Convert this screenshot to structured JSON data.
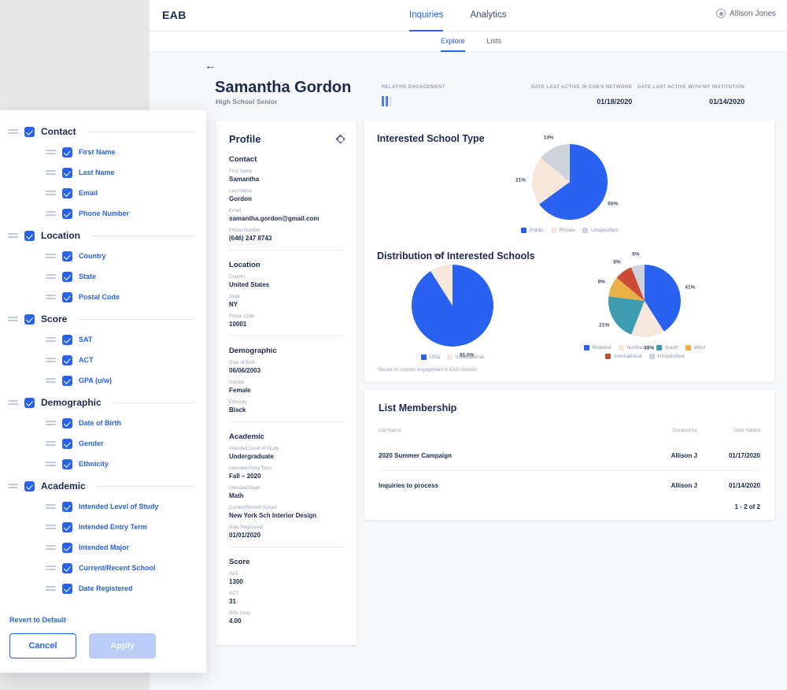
{
  "topbar": {
    "brand": "EAB",
    "nav": [
      {
        "label": "Inquiries",
        "active": true
      },
      {
        "label": "Analytics",
        "active": false
      }
    ],
    "user": "Allison Jones",
    "user_icon": "avatar-icon"
  },
  "subnav": [
    {
      "label": "Explore",
      "active": true
    },
    {
      "label": "Lists",
      "active": false
    }
  ],
  "person": {
    "back_icon": "back-arrow-icon",
    "name": "Samantha Gordon",
    "subtitle": "High School Senior",
    "metrics": [
      {
        "label": "RELATIVE ENGAGEMENT",
        "value": "",
        "bars_on": 2,
        "bars_total": 3
      },
      {
        "label": "DATE LAST ACTIVE IN EAB'S NETWORK",
        "value": "01/18/2020"
      },
      {
        "label": "DATE LAST ACTIVE WITH MY INSTITUTION",
        "value": "01/14/2020"
      }
    ]
  },
  "profile": {
    "title": "Profile",
    "settings_icon": "gear-icon",
    "sections": [
      {
        "title": "Contact",
        "fields": [
          {
            "label": "First Name",
            "value": "Samantha"
          },
          {
            "label": "Last Name",
            "value": "Gordon"
          },
          {
            "label": "Email",
            "value": "samantha.gordon@gmail.com"
          },
          {
            "label": "Phone Number",
            "value": "(646) 247 8743"
          }
        ]
      },
      {
        "title": "Location",
        "fields": [
          {
            "label": "Country",
            "value": "United States"
          },
          {
            "label": "State",
            "value": "NY"
          },
          {
            "label": "Postal Code",
            "value": "10001"
          }
        ]
      },
      {
        "title": "Demographic",
        "fields": [
          {
            "label": "Date of Birth",
            "value": "06/06/2003"
          },
          {
            "label": "Gender",
            "value": "Female"
          },
          {
            "label": "Ethnicity",
            "value": "Black"
          }
        ]
      },
      {
        "title": "Academic",
        "fields": [
          {
            "label": "Intended Level of Study",
            "value": "Undergraduate"
          },
          {
            "label": "Intended Entry Term",
            "value": "Fall – 2020"
          },
          {
            "label": "Intended Major",
            "value": "Math"
          },
          {
            "label": "Current/Recent School",
            "value": "New York Sch Interior Design"
          },
          {
            "label": "Date Registered",
            "value": "01/01/2020"
          }
        ]
      },
      {
        "title": "Score",
        "fields": [
          {
            "label": "SAT",
            "value": "1300"
          },
          {
            "label": "ACT",
            "value": "31"
          },
          {
            "label": "GPA (u/w)",
            "value": "4.00"
          }
        ]
      }
    ]
  },
  "charts_section": {
    "footnote": "*Based on content engagement in EAB network"
  },
  "chart_data": [
    {
      "type": "pie",
      "title": "Interested School Type",
      "categories": [
        "Public",
        "Private",
        "Unspecified"
      ],
      "values": [
        65,
        21,
        14
      ],
      "labels": [
        "65%",
        "21%",
        "14%"
      ],
      "colors": [
        "#2962f0",
        "#f6e7da",
        "#cfd4dc"
      ],
      "legend_position": "bottom",
      "start_angle": 0
    },
    {
      "type": "pie",
      "title": "Distribution of Interested Schools",
      "subchart": "geography",
      "categories": [
        "USA",
        "International"
      ],
      "values": [
        91.0,
        9
      ],
      "labels": [
        "91.0%",
        "9%"
      ],
      "colors": [
        "#2962f0",
        "#f6e7da"
      ],
      "legend_position": "bottom",
      "start_angle": 0
    },
    {
      "type": "pie",
      "title": "Distribution of Interested Schools",
      "subchart": "region",
      "categories": [
        "Midwest",
        "Northeast",
        "South",
        "West",
        "International",
        "Unspecified"
      ],
      "values": [
        41,
        15,
        21,
        9,
        8,
        6
      ],
      "labels": [
        "41%",
        "15%",
        "21%",
        "9%",
        "8%",
        "6%"
      ],
      "colors": [
        "#2962f0",
        "#f6e7da",
        "#3d9cb0",
        "#e8b146",
        "#cc4b37",
        "#cfd4dc"
      ],
      "legend_position": "bottom",
      "start_angle": 0
    }
  ],
  "list_membership": {
    "title": "List Membership",
    "columns": [
      "List Name",
      "Created by",
      "Date Added"
    ],
    "rows": [
      {
        "name": "2020 Summer Campaign",
        "created_by": "Allison J",
        "date_added": "01/17/2020"
      },
      {
        "name": "Inquiries to process",
        "created_by": "Allison J",
        "date_added": "01/14/2020"
      }
    ],
    "pager": "1 - 2 of 2"
  },
  "column_panel": {
    "groups": [
      {
        "label": "Contact",
        "checked": true,
        "children": [
          {
            "label": "First Name",
            "checked": true
          },
          {
            "label": "Last Name",
            "checked": true
          },
          {
            "label": "Email",
            "checked": true
          },
          {
            "label": "Phone Number",
            "checked": true
          }
        ]
      },
      {
        "label": "Location",
        "checked": true,
        "children": [
          {
            "label": "Country",
            "checked": true
          },
          {
            "label": "State",
            "checked": true
          },
          {
            "label": "Postal Code",
            "checked": true
          }
        ]
      },
      {
        "label": "Score",
        "checked": true,
        "children": [
          {
            "label": "SAT",
            "checked": true
          },
          {
            "label": "ACT",
            "checked": true
          },
          {
            "label": "GPA (u/w)",
            "checked": true
          }
        ]
      },
      {
        "label": "Demographic",
        "checked": true,
        "children": [
          {
            "label": "Date of Birth",
            "checked": true
          },
          {
            "label": "Gender",
            "checked": true
          },
          {
            "label": "Ethnicity",
            "checked": true
          }
        ]
      },
      {
        "label": "Academic",
        "checked": true,
        "children": [
          {
            "label": "Intended Level of Study",
            "checked": true
          },
          {
            "label": "Intended Entry Term",
            "checked": true
          },
          {
            "label": "Intended Major",
            "checked": true
          },
          {
            "label": "Current/Recent School",
            "checked": true
          },
          {
            "label": "Date Registered",
            "checked": true
          }
        ]
      }
    ],
    "revert_label": "Revert to Default",
    "cancel_label": "Cancel",
    "apply_label": "Apply"
  },
  "theme": {
    "accent": "#2962f0",
    "text_dark": "#1b2a4e",
    "text_muted": "#9aa3b5",
    "page_bg": "#f7f8fa",
    "outer_bg": "#e8e8e8"
  }
}
